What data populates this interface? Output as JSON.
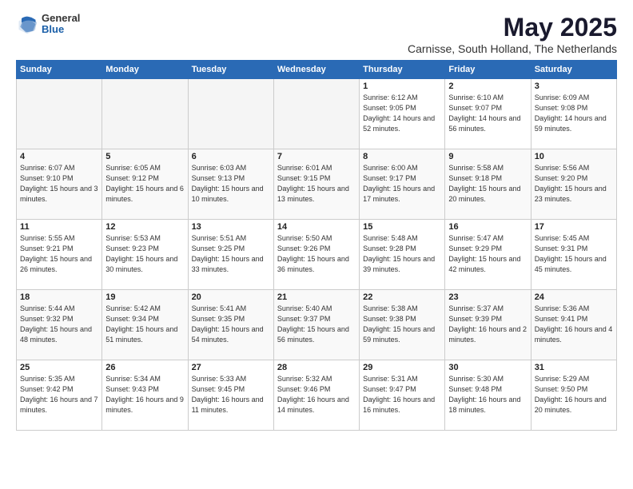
{
  "header": {
    "logo_general": "General",
    "logo_blue": "Blue",
    "month_title": "May 2025",
    "subtitle": "Carnisse, South Holland, The Netherlands"
  },
  "weekdays": [
    "Sunday",
    "Monday",
    "Tuesday",
    "Wednesday",
    "Thursday",
    "Friday",
    "Saturday"
  ],
  "rows": [
    [
      {
        "day": "",
        "empty": true
      },
      {
        "day": "",
        "empty": true
      },
      {
        "day": "",
        "empty": true
      },
      {
        "day": "",
        "empty": true
      },
      {
        "day": "1",
        "sunrise": "6:12 AM",
        "sunset": "9:05 PM",
        "daylight": "14 hours and 52 minutes."
      },
      {
        "day": "2",
        "sunrise": "6:10 AM",
        "sunset": "9:07 PM",
        "daylight": "14 hours and 56 minutes."
      },
      {
        "day": "3",
        "sunrise": "6:09 AM",
        "sunset": "9:08 PM",
        "daylight": "14 hours and 59 minutes."
      }
    ],
    [
      {
        "day": "4",
        "sunrise": "6:07 AM",
        "sunset": "9:10 PM",
        "daylight": "15 hours and 3 minutes."
      },
      {
        "day": "5",
        "sunrise": "6:05 AM",
        "sunset": "9:12 PM",
        "daylight": "15 hours and 6 minutes."
      },
      {
        "day": "6",
        "sunrise": "6:03 AM",
        "sunset": "9:13 PM",
        "daylight": "15 hours and 10 minutes."
      },
      {
        "day": "7",
        "sunrise": "6:01 AM",
        "sunset": "9:15 PM",
        "daylight": "15 hours and 13 minutes."
      },
      {
        "day": "8",
        "sunrise": "6:00 AM",
        "sunset": "9:17 PM",
        "daylight": "15 hours and 17 minutes."
      },
      {
        "day": "9",
        "sunrise": "5:58 AM",
        "sunset": "9:18 PM",
        "daylight": "15 hours and 20 minutes."
      },
      {
        "day": "10",
        "sunrise": "5:56 AM",
        "sunset": "9:20 PM",
        "daylight": "15 hours and 23 minutes."
      }
    ],
    [
      {
        "day": "11",
        "sunrise": "5:55 AM",
        "sunset": "9:21 PM",
        "daylight": "15 hours and 26 minutes."
      },
      {
        "day": "12",
        "sunrise": "5:53 AM",
        "sunset": "9:23 PM",
        "daylight": "15 hours and 30 minutes."
      },
      {
        "day": "13",
        "sunrise": "5:51 AM",
        "sunset": "9:25 PM",
        "daylight": "15 hours and 33 minutes."
      },
      {
        "day": "14",
        "sunrise": "5:50 AM",
        "sunset": "9:26 PM",
        "daylight": "15 hours and 36 minutes."
      },
      {
        "day": "15",
        "sunrise": "5:48 AM",
        "sunset": "9:28 PM",
        "daylight": "15 hours and 39 minutes."
      },
      {
        "day": "16",
        "sunrise": "5:47 AM",
        "sunset": "9:29 PM",
        "daylight": "15 hours and 42 minutes."
      },
      {
        "day": "17",
        "sunrise": "5:45 AM",
        "sunset": "9:31 PM",
        "daylight": "15 hours and 45 minutes."
      }
    ],
    [
      {
        "day": "18",
        "sunrise": "5:44 AM",
        "sunset": "9:32 PM",
        "daylight": "15 hours and 48 minutes."
      },
      {
        "day": "19",
        "sunrise": "5:42 AM",
        "sunset": "9:34 PM",
        "daylight": "15 hours and 51 minutes."
      },
      {
        "day": "20",
        "sunrise": "5:41 AM",
        "sunset": "9:35 PM",
        "daylight": "15 hours and 54 minutes."
      },
      {
        "day": "21",
        "sunrise": "5:40 AM",
        "sunset": "9:37 PM",
        "daylight": "15 hours and 56 minutes."
      },
      {
        "day": "22",
        "sunrise": "5:38 AM",
        "sunset": "9:38 PM",
        "daylight": "15 hours and 59 minutes."
      },
      {
        "day": "23",
        "sunrise": "5:37 AM",
        "sunset": "9:39 PM",
        "daylight": "16 hours and 2 minutes."
      },
      {
        "day": "24",
        "sunrise": "5:36 AM",
        "sunset": "9:41 PM",
        "daylight": "16 hours and 4 minutes."
      }
    ],
    [
      {
        "day": "25",
        "sunrise": "5:35 AM",
        "sunset": "9:42 PM",
        "daylight": "16 hours and 7 minutes."
      },
      {
        "day": "26",
        "sunrise": "5:34 AM",
        "sunset": "9:43 PM",
        "daylight": "16 hours and 9 minutes."
      },
      {
        "day": "27",
        "sunrise": "5:33 AM",
        "sunset": "9:45 PM",
        "daylight": "16 hours and 11 minutes."
      },
      {
        "day": "28",
        "sunrise": "5:32 AM",
        "sunset": "9:46 PM",
        "daylight": "16 hours and 14 minutes."
      },
      {
        "day": "29",
        "sunrise": "5:31 AM",
        "sunset": "9:47 PM",
        "daylight": "16 hours and 16 minutes."
      },
      {
        "day": "30",
        "sunrise": "5:30 AM",
        "sunset": "9:48 PM",
        "daylight": "16 hours and 18 minutes."
      },
      {
        "day": "31",
        "sunrise": "5:29 AM",
        "sunset": "9:50 PM",
        "daylight": "16 hours and 20 minutes."
      }
    ]
  ]
}
